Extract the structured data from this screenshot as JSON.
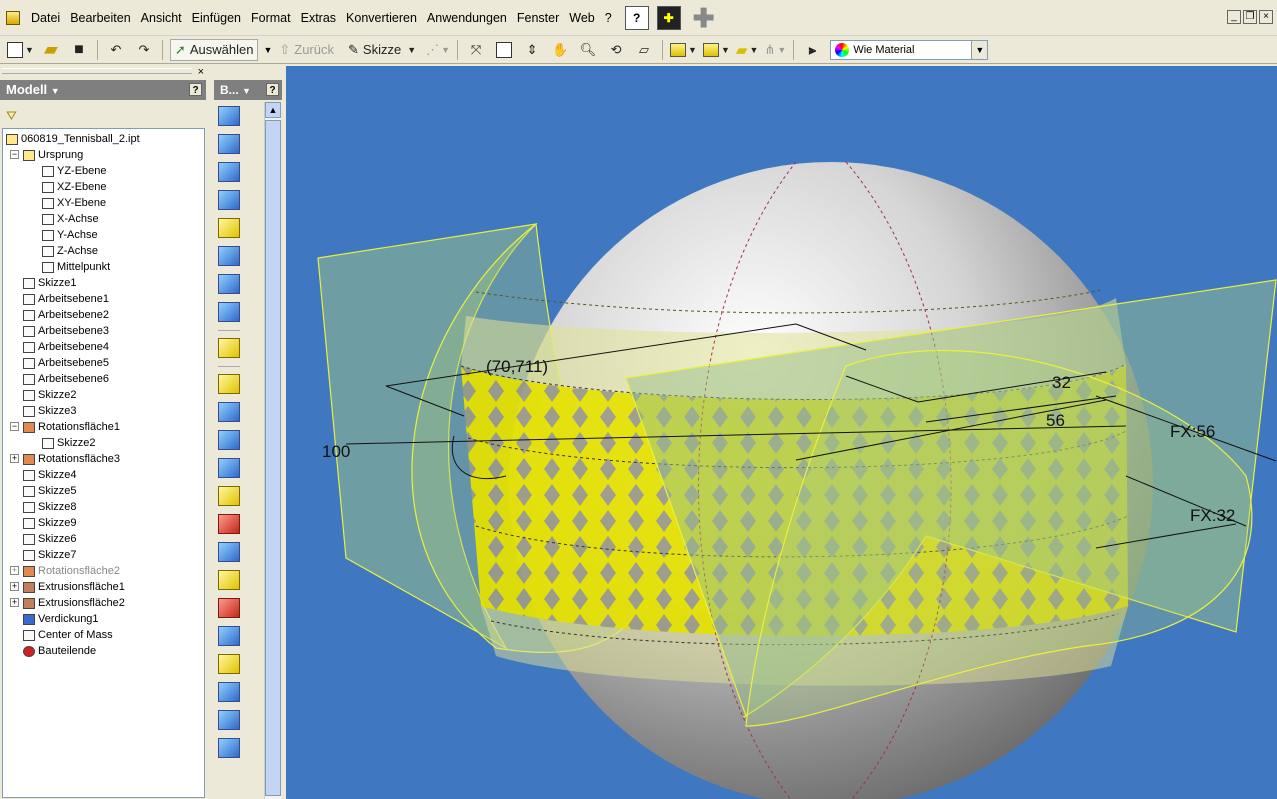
{
  "menu": [
    "Datei",
    "Bearbeiten",
    "Ansicht",
    "Einfügen",
    "Format",
    "Extras",
    "Konvertieren",
    "Anwendungen",
    "Fenster",
    "Web",
    "?"
  ],
  "toolbar": {
    "select_label": "Auswählen",
    "back_label": "Zurück",
    "sketch_label": "Skizze",
    "material_value": "Wie Material"
  },
  "browser": {
    "title": "Modell",
    "help": "?",
    "close": "×",
    "root": "060819_Tennisball_2.ipt",
    "items": [
      {
        "label": "Ursprung",
        "level": 1,
        "expander": "−"
      },
      {
        "label": "YZ-Ebene",
        "level": 2
      },
      {
        "label": "XZ-Ebene",
        "level": 2
      },
      {
        "label": "XY-Ebene",
        "level": 2
      },
      {
        "label": "X-Achse",
        "level": 2
      },
      {
        "label": "Y-Achse",
        "level": 2
      },
      {
        "label": "Z-Achse",
        "level": 2
      },
      {
        "label": "Mittelpunkt",
        "level": 2
      },
      {
        "label": "Skizze1",
        "level": 1
      },
      {
        "label": "Arbeitsebene1",
        "level": 1
      },
      {
        "label": "Arbeitsebene2",
        "level": 1
      },
      {
        "label": "Arbeitsebene3",
        "level": 1
      },
      {
        "label": "Arbeitsebene4",
        "level": 1
      },
      {
        "label": "Arbeitsebene5",
        "level": 1
      },
      {
        "label": "Arbeitsebene6",
        "level": 1
      },
      {
        "label": "Skizze2",
        "level": 1
      },
      {
        "label": "Skizze3",
        "level": 1
      },
      {
        "label": "Rotationsfläche1",
        "level": 1,
        "expander": "−"
      },
      {
        "label": "Skizze2",
        "level": 2
      },
      {
        "label": "Rotationsfläche3",
        "level": 1,
        "expander": "+"
      },
      {
        "label": "Skizze4",
        "level": 1
      },
      {
        "label": "Skizze5",
        "level": 1
      },
      {
        "label": "Skizze8",
        "level": 1
      },
      {
        "label": "Skizze9",
        "level": 1
      },
      {
        "label": "Skizze6",
        "level": 1
      },
      {
        "label": "Skizze7",
        "level": 1
      },
      {
        "label": "Rotationsfläche2",
        "level": 1,
        "expander": "+",
        "disabled": true
      },
      {
        "label": "Extrusionsfläche1",
        "level": 1,
        "expander": "+"
      },
      {
        "label": "Extrusionsfläche2",
        "level": 1,
        "expander": "+"
      },
      {
        "label": "Verdickung1",
        "level": 1
      },
      {
        "label": "Center of Mass",
        "level": 1
      },
      {
        "label": "Bauteilende",
        "level": 1
      }
    ]
  },
  "panel2": {
    "title": "B...",
    "help": "?"
  },
  "viewport": {
    "dimensions": [
      "(70,711)",
      "32",
      "56",
      "100",
      "FX:56",
      "FX:32"
    ]
  },
  "window_controls": [
    "_",
    "❐",
    "×"
  ]
}
